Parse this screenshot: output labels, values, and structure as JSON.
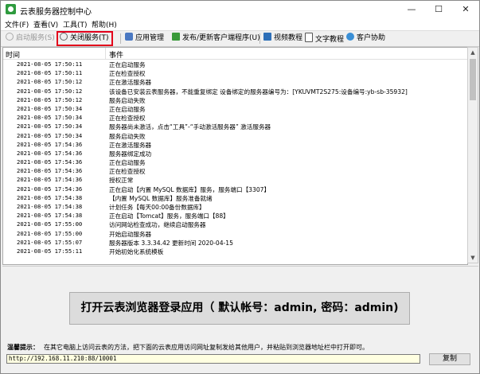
{
  "window": {
    "title": "云表服务器控制中心",
    "minimize": "—",
    "maximize": "☐",
    "close": "✕"
  },
  "menu": [
    "文件(F)",
    "查看(V)",
    "工具(T)",
    "帮助(H)"
  ],
  "toolbar": {
    "start_service": "启动服务(S)",
    "stop_service": "关闭服务(T)",
    "app_manage": "应用管理",
    "publish_client": "发布/更新客户端程序(U)",
    "video_tutorial": "视频教程",
    "text_tutorial": "文字教程",
    "customer_help": "客户协助"
  },
  "log": {
    "col_time": "时间",
    "col_event": "事件",
    "rows": [
      {
        "time": "2021-08-05 17:50:11",
        "event": "正在启动服务"
      },
      {
        "time": "2021-08-05 17:50:11",
        "event": "正在检查授权"
      },
      {
        "time": "2021-08-05 17:50:12",
        "event": "正在激活服务器"
      },
      {
        "time": "2021-08-05 17:50:12",
        "event": "该设备已安装云表服务器，不能重复绑定 设备绑定的服务器编号为：[YKUVMT2S275:设备编号:yb-sb-35932]"
      },
      {
        "time": "2021-08-05 17:50:12",
        "event": "服务启动失败"
      },
      {
        "time": "2021-08-05 17:50:34",
        "event": "正在启动服务"
      },
      {
        "time": "2021-08-05 17:50:34",
        "event": "正在检查授权"
      },
      {
        "time": "2021-08-05 17:50:34",
        "event": "服务器尚未激活，点击“工具”-“手动激活服务器” 激活服务器"
      },
      {
        "time": "2021-08-05 17:50:34",
        "event": "服务启动失败"
      },
      {
        "time": "2021-08-05 17:54:36",
        "event": "正在激活服务器"
      },
      {
        "time": "2021-08-05 17:54:36",
        "event": "服务器绑定成功"
      },
      {
        "time": "2021-08-05 17:54:36",
        "event": "正在启动服务"
      },
      {
        "time": "2021-08-05 17:54:36",
        "event": "正在检查授权"
      },
      {
        "time": "2021-08-05 17:54:36",
        "event": "授权正常"
      },
      {
        "time": "2021-08-05 17:54:36",
        "event": "正在启动【内置 MySQL 数据库】服务，服务端口【3307】"
      },
      {
        "time": "2021-08-05 17:54:38",
        "event": "【内置 MySQL 数据库】服务准备就绪"
      },
      {
        "time": "2021-08-05 17:54:38",
        "event": "计划任务【每天00:00备份数据库】"
      },
      {
        "time": "2021-08-05 17:54:38",
        "event": "正在启动【Tomcat】服务，服务端口【88】"
      },
      {
        "time": "2021-08-05 17:55:00",
        "event": "访问网站检查成功，继续启动服务器"
      },
      {
        "time": "2021-08-05 17:55:00",
        "event": "开始启动服务器"
      },
      {
        "time": "2021-08-05 17:55:07",
        "event": "服务器版本  3.3.34.42 更新时间 2020-04-15"
      },
      {
        "time": "2021-08-05 17:55:11",
        "event": "开始初始化系统模板"
      }
    ]
  },
  "open_app_button": "打开云表浏览器登录应用（ 默认帐号：admin, 密码：admin)",
  "tip_label": "温馨提示：",
  "tip_text": "在其它电脑上访问云表的方法，把下面的云表应用访问网址复制发给其他用户，并粘贴到浏览器地址栏中打开即可。",
  "url": "http://192.168.11.210:88/10001",
  "copy_button": "复制",
  "colors": {
    "highlight": "#e3001b",
    "url_bg": "#ffffe1"
  }
}
